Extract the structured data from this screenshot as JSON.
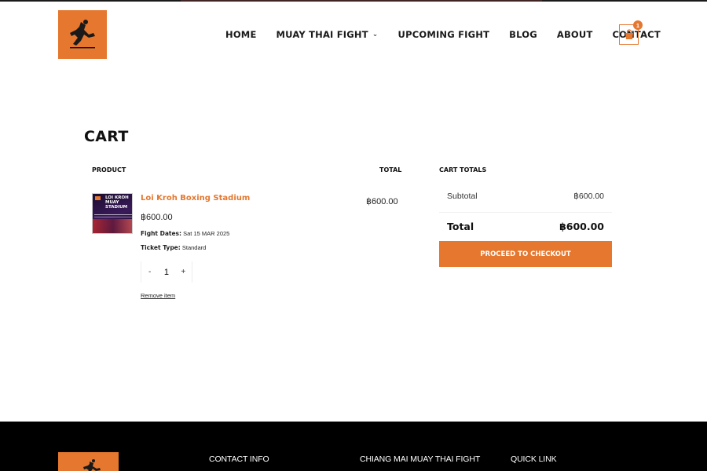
{
  "header": {
    "nav": [
      {
        "label": "HOME"
      },
      {
        "label": "MUAY THAI FIGHT",
        "has_submenu": true
      },
      {
        "label": "UPCOMING FIGHT"
      },
      {
        "label": "BLOG"
      },
      {
        "label": "ABOUT"
      },
      {
        "label": "CONTACT"
      }
    ],
    "cart_count": "1",
    "submenu_icon": "chevron-down-icon",
    "cart_icon": "shopping-bag-icon"
  },
  "cart": {
    "title": "CART",
    "columns": {
      "product": "PRODUCT",
      "total": "TOTAL"
    },
    "items": [
      {
        "thumbnail_text": "LOI KROH MUAY STADIUM",
        "name": "Loi Kroh Boxing Stadium",
        "price": "฿600.00",
        "fight_dates_label": "Fight Dates:",
        "fight_dates_value": "Sat 15 MAR 2025",
        "ticket_type_label": "Ticket Type:",
        "ticket_type_value": "Standard",
        "qty_minus": "-",
        "quantity": "1",
        "qty_plus": "+",
        "remove_label": "Remove item",
        "line_total": "฿600.00"
      }
    ]
  },
  "totals": {
    "title": "CART TOTALS",
    "subtotal_label": "Subtotal",
    "subtotal_value": "฿600.00",
    "total_label": "Total",
    "total_value": "฿600.00",
    "checkout_label": "PROCEED TO CHECKOUT"
  },
  "footer": {
    "headings": [
      "CONTACT INFO",
      "CHIANG MAI MUAY THAI FIGHT",
      "QUICK LINK"
    ]
  },
  "colors": {
    "accent": "#e5772e",
    "footer_bg": "#000000",
    "text": "#111111"
  }
}
